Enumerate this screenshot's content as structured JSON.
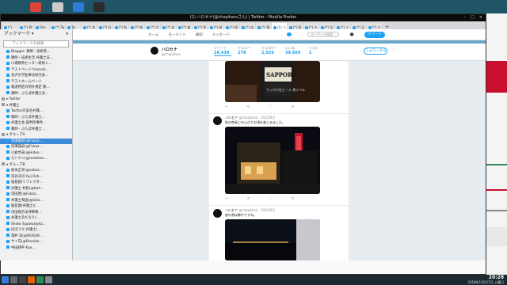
{
  "desktop": {
    "top_icons": [
      {
        "name": "app-icon-1",
        "color": "#e0433a"
      },
      {
        "name": "app-icon-2",
        "color": "#cccccc"
      },
      {
        "name": "app-icon-3",
        "color": "#2f7bd8"
      },
      {
        "name": "app-icon-4",
        "color": "#2b2b2b"
      }
    ]
  },
  "window": {
    "title": "(1) ハロセナ(@chopitanoさん) | Twitter - Mozilla Firefox",
    "controls": [
      "–",
      "□",
      "×"
    ]
  },
  "tabs": [
    {
      "label": "(*)",
      "active": false
    },
    {
      "label": "(*) W",
      "active": false
    },
    {
      "label": "Sho",
      "active": false
    },
    {
      "label": "(*) Tw",
      "active": false
    },
    {
      "label": "Tw",
      "active": false
    },
    {
      "label": "(*) 本",
      "active": false
    },
    {
      "label": "(*) 日",
      "active": false
    },
    {
      "label": "(*) 私",
      "active": false
    },
    {
      "label": "(*) 知",
      "active": false
    },
    {
      "label": "(*) 大",
      "active": false
    },
    {
      "label": "(*) 本",
      "active": false
    },
    {
      "label": "(*) 楽",
      "active": false
    },
    {
      "label": "(*) 多",
      "active": false
    },
    {
      "label": "(*) 研",
      "active": false
    },
    {
      "label": "(*) 知",
      "active": false
    },
    {
      "label": "(*) 広",
      "active": false
    },
    {
      "label": "(*) 堀",
      "active": false
    },
    {
      "label": "(1) ハ",
      "active": true
    },
    {
      "label": "(*) 研",
      "active": false
    },
    {
      "label": "(*) 川",
      "active": false
    },
    {
      "label": "(*) 吉",
      "active": false
    },
    {
      "label": "(*) デ",
      "active": false
    },
    {
      "label": "(*) 日",
      "active": false
    },
    {
      "label": "(*) ツ",
      "active": false
    }
  ],
  "navbar": {
    "url": "https://twitter.com/chopitano",
    "search_placeholder": "検索"
  },
  "sidebar": {
    "title": "ブックマーク ▾",
    "close": "×",
    "search_placeholder": "ブックマークを検索",
    "items": [
      {
        "label": "Blogger: 教師・技術系…",
        "type": "bm",
        "sel": false
      },
      {
        "label": "教師・技術生活 弁護士法…",
        "type": "bm",
        "sel": false
      },
      {
        "label": "川場教育センター研修入…",
        "type": "bm",
        "sel": false
      },
      {
        "label": "テストページ hironoti…",
        "type": "bm",
        "sel": false
      },
      {
        "label": "金沢大学医事法研究会…",
        "type": "bm",
        "sel": false
      },
      {
        "label": "テストホームページ",
        "type": "bm",
        "sel": false
      },
      {
        "label": "報道特定の例外規定 教…",
        "type": "bm",
        "sel": false
      },
      {
        "label": "教師・ぶらぼ弁護士法…",
        "type": "bm",
        "sel": false
      },
      {
        "label": "▸ Twitter",
        "type": "folder",
        "sel": false
      },
      {
        "label": "▾ 弁護士",
        "type": "folder",
        "sel": false
      },
      {
        "label": "Twitterの実名弁護…",
        "type": "bm",
        "sel": false
      },
      {
        "label": "教師・ぶらぼ弁護士…",
        "type": "bm",
        "sel": false
      },
      {
        "label": "弁護士会 裁判所事件…",
        "type": "bm",
        "sel": false
      },
      {
        "label": "教師・ぶらぼ弁護士…",
        "type": "bm",
        "sel": false
      },
      {
        "label": "▾ グループA",
        "type": "folder",
        "sel": false
      },
      {
        "label": "深澤諭史(@Fukaz…",
        "type": "bm",
        "sel": true
      },
      {
        "label": "深澤諭史(@Fukaz…",
        "type": "bm",
        "sel": false
      },
      {
        "label": "小倉秀夫(@Hideo…",
        "type": "bm",
        "sel": false
      },
      {
        "label": "モトケン(@motoken…",
        "type": "bm",
        "sel": false
      },
      {
        "label": "▾ グループB",
        "type": "folder",
        "sel": false
      },
      {
        "label": "板本正幸(@sakaa…",
        "type": "bm",
        "sel": false
      },
      {
        "label": "深谷洋司 Yuji Osh…",
        "type": "bm",
        "sel": false
      },
      {
        "label": "福島創(リフレクタ…",
        "type": "bm",
        "sel": false
      },
      {
        "label": "弁護士 村松(@tam…",
        "type": "bm",
        "sel": false
      },
      {
        "label": "深田善(@Fukaz…",
        "type": "bm",
        "sel": false
      },
      {
        "label": "弁護士和田(@tata…",
        "type": "bm",
        "sel": false
      },
      {
        "label": "鹿島健(弁護士)(…",
        "type": "bm",
        "sel": false
      },
      {
        "label": "内田総合法律事務…",
        "type": "bm",
        "sel": false
      },
      {
        "label": "弁護士あだちり(…",
        "type": "bm",
        "sel": false
      },
      {
        "label": "Shoko Egawa(@ka…",
        "type": "bm",
        "sel": false
      },
      {
        "label": "ぼぼうか 弁護士(…",
        "type": "bm",
        "sel": false
      },
      {
        "label": "澤井 浩(@NOGUK…",
        "type": "bm",
        "sel": false
      },
      {
        "label": "サイ氏(@Poseido…",
        "type": "bm",
        "sel": false
      },
      {
        "label": "中田耕平 Koo…",
        "type": "bm",
        "sel": false
      }
    ]
  },
  "twitter": {
    "nav": {
      "home": "ホーム",
      "moments": "モーメント",
      "notifications": "通知",
      "messages": "メッセージ",
      "search_placeholder": "キーワード検索",
      "tweet_button": "ツイート"
    },
    "profile": {
      "name": "ハロセナ",
      "handle": "@chopitano",
      "follow_label": "フォローする",
      "stats": [
        {
          "label": "ツイート",
          "value": "26,430",
          "active": true
        },
        {
          "label": "フォロー",
          "value": "278",
          "active": false
        },
        {
          "label": "フォロワー",
          "value": "2,029",
          "active": false
        },
        {
          "label": "いいね",
          "value": "39,669",
          "active": false
        },
        {
          "label": "リスト",
          "value": "2",
          "active": false
        }
      ]
    },
    "tweets": [
      {
        "author": "ハロセナ",
        "handle": "@chopitano · 10月26日",
        "text": "秋の夜長にのんびりお酒を楽しみました。",
        "actions": [
          "↩",
          "⟲",
          "♡",
          "✉"
        ]
      },
      {
        "author": "ハロセナ",
        "handle": "@chopitano · 10月26日",
        "text": "夜の港は静かですね。",
        "actions": [
          "↩",
          "⟲",
          "♡",
          "✉"
        ]
      }
    ],
    "first_photo_text": "SAPPORO",
    "first_photo_sub": "サッポロ生ビール 黒ラベル"
  },
  "taskbar": {
    "icons": [
      {
        "name": "start-icon",
        "color": "#3a7bd5"
      },
      {
        "name": "files-icon",
        "color": "#666666"
      },
      {
        "name": "terminal-icon",
        "color": "#444444"
      },
      {
        "name": "firefox-icon",
        "color": "#e66000"
      },
      {
        "name": "app-icon-5",
        "color": "#2e8b57"
      },
      {
        "name": "app-icon-6",
        "color": "#888888"
      }
    ],
    "clock": "20:28",
    "date": "2018年10月27日 土曜日"
  }
}
